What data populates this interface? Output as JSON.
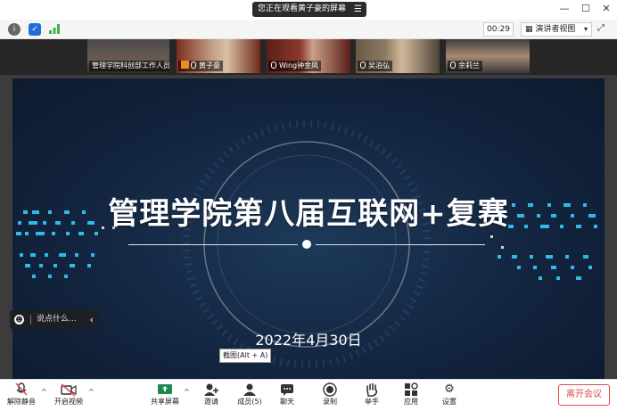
{
  "titlebar": {
    "share_notice": "您正在观看黄子豪的屏幕",
    "menu_icon": "hamburger-icon",
    "minimize": "—",
    "maximize": "☐",
    "close": "✕"
  },
  "infobar": {
    "timer": "00:29",
    "view_mode": "演讲者视图",
    "icons": [
      "info-icon",
      "shield-icon",
      "signal-icon",
      "fullscreen-icon"
    ]
  },
  "gallery": [
    {
      "name": "管理学院科创部工作人员",
      "muted": false,
      "active": false
    },
    {
      "name": "黄子豪",
      "muted": false,
      "active": false
    },
    {
      "name": "Wing钟金凤",
      "muted": false,
      "active": false
    },
    {
      "name": "吴泊弘",
      "muted": false,
      "active": true
    },
    {
      "name": "余莉兰",
      "muted": false,
      "active": false
    }
  ],
  "slide": {
    "title": "管理学院第八届互联网+复赛",
    "date": "2022年4月30日"
  },
  "chat": {
    "placeholder": "说点什么..."
  },
  "tooltip": "截图(Alt + A)",
  "toolbar": {
    "unmute": "解除静音",
    "start_video": "开启视频",
    "share_screen": "共享屏幕",
    "invite": "邀请",
    "members": "成员(5)",
    "chat": "聊天",
    "record": "录制",
    "raise_hand": "举手",
    "apps": "应用",
    "settings": "设置",
    "leave": "离开会议"
  },
  "colors": {
    "slide_bg": "#13243f",
    "accent_cyan": "#2fb8e8",
    "active_speaker": "#3ab54a",
    "leave_red": "#e04b4b"
  }
}
